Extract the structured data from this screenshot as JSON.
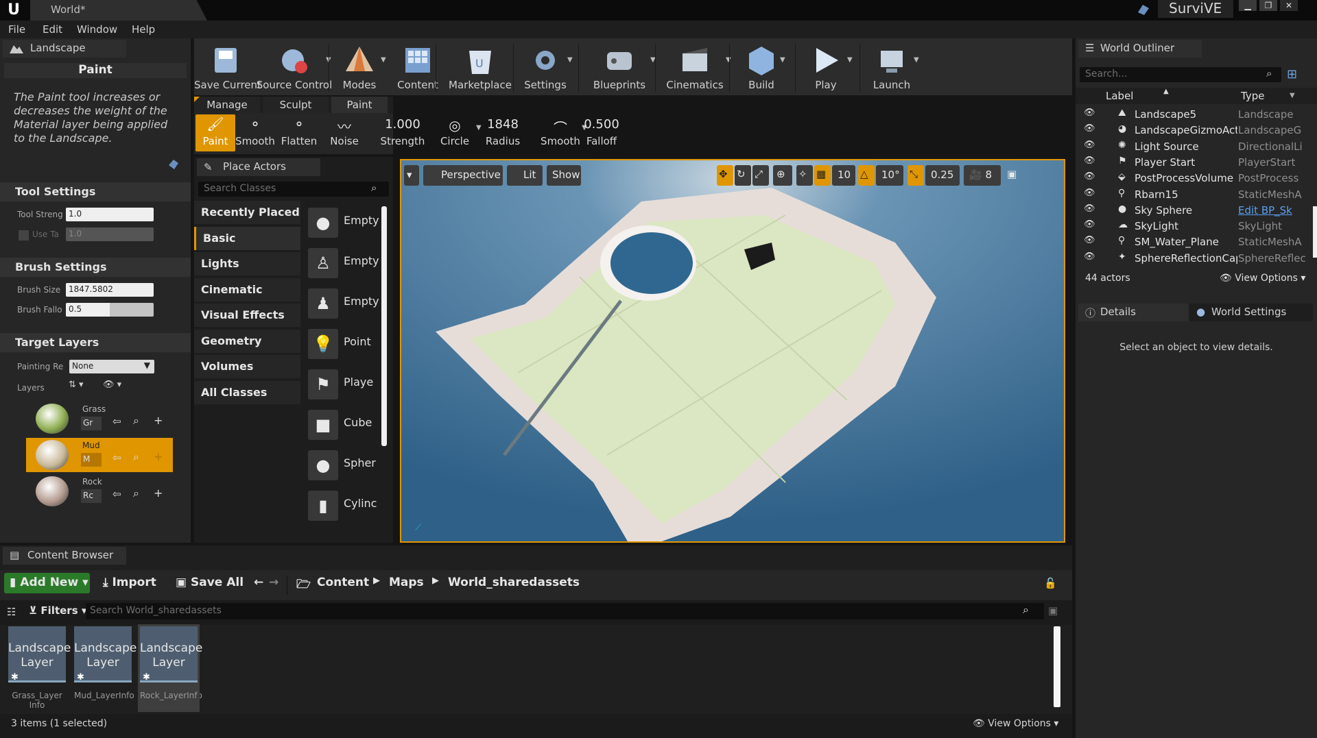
{
  "window": {
    "tab_title": "World*",
    "project_name": "SurviVE"
  },
  "menu": [
    "File",
    "Edit",
    "Window",
    "Help"
  ],
  "landscape_panel": {
    "tab": "Landscape",
    "mode_title": "Paint",
    "description": "The Paint tool increases or decreases the weight of the Material layer being applied to the Landscape.",
    "tool_settings": {
      "header": "Tool Settings",
      "tool_strength_label": "Tool Streng",
      "tool_strength_value": "1.0",
      "use_target_label": "Use Ta",
      "use_target_value": "1.0"
    },
    "brush_settings": {
      "header": "Brush Settings",
      "brush_size_label": "Brush Size",
      "brush_size_value": "1847.5802",
      "brush_falloff_label": "Brush Fallo",
      "brush_falloff_value": "0.5",
      "brush_falloff_fraction": 0.5
    },
    "target_layers": {
      "header": "Target Layers",
      "painting_label": "Painting Re",
      "painting_value": "None",
      "layers_label": "Layers",
      "items": [
        {
          "name": "Grass",
          "info": "Gr",
          "color": "#8fae52"
        },
        {
          "name": "Mud",
          "info": "M",
          "color": "#c9b99a"
        },
        {
          "name": "Rock",
          "info": "Rc",
          "color": "#b49b8f"
        }
      ]
    }
  },
  "toolbar": {
    "buttons": [
      "Save Current",
      "Source Control",
      "Modes",
      "Content",
      "Marketplace",
      "Settings",
      "Blueprints",
      "Cinematics",
      "Build",
      "Play",
      "Launch"
    ]
  },
  "mode_tabs": [
    "Manage",
    "Sculpt",
    "Paint"
  ],
  "paint_tools": [
    "Paint",
    "Smooth",
    "Flatten",
    "Noise"
  ],
  "paint_params": [
    {
      "value": "1.000",
      "label": "Strength"
    },
    {
      "value": "",
      "label": "Circle"
    },
    {
      "value": "1848",
      "label": "Radius"
    },
    {
      "value": "",
      "label": "Smooth"
    },
    {
      "value": "0.500",
      "label": "Falloff"
    }
  ],
  "place_actors": {
    "tab": "Place Actors",
    "search_placeholder": "Search Classes",
    "categories": [
      "Recently Placed",
      "Basic",
      "Lights",
      "Cinematic",
      "Visual Effects",
      "Geometry",
      "Volumes",
      "All Classes"
    ],
    "selected_category": "Basic",
    "items": [
      "Empty",
      "Empty",
      "Empty",
      "Point",
      "Playe",
      "Cube",
      "Spher",
      "Cylinc"
    ]
  },
  "viewport": {
    "perspective": "Perspective",
    "lit": "Lit",
    "show": "Show",
    "grid_snap": "10",
    "rot_snap": "10°",
    "scale_snap": "0.25",
    "camera_speed": "8"
  },
  "outliner": {
    "tab": "World Outliner",
    "search_placeholder": "Search...",
    "col_label": "Label",
    "col_type": "Type",
    "rows": [
      {
        "name": "Landscape5",
        "type": "Landscape"
      },
      {
        "name": "LandscapeGizmoActi",
        "type": "LandscapeG"
      },
      {
        "name": "Light Source",
        "type": "DirectionalLi"
      },
      {
        "name": "Player Start",
        "type": "PlayerStart"
      },
      {
        "name": "PostProcessVolume",
        "type": "PostProcess"
      },
      {
        "name": "Rbarn15",
        "type": "StaticMeshA"
      },
      {
        "name": "Sky Sphere",
        "type": "Edit BP_Sk"
      },
      {
        "name": "SkyLight",
        "type": "SkyLight"
      },
      {
        "name": "SM_Water_Plane",
        "type": "StaticMeshA"
      },
      {
        "name": "SphereReflectionCapt",
        "type": "SphereReflec"
      }
    ],
    "count": "44 actors",
    "view_options": "View Options"
  },
  "details": {
    "tab": "Details",
    "tab2": "World Settings",
    "empty_text": "Select an object to view details."
  },
  "content_browser": {
    "tab": "Content Browser",
    "add_new": "Add New",
    "import": "Import",
    "save_all": "Save All",
    "path": [
      "Content",
      "Maps",
      "World_sharedassets"
    ],
    "filters": "Filters",
    "search_placeholder": "Search World_sharedassets",
    "assets": [
      {
        "thumb": "Landscape Layer",
        "name": "Grass_Layer Info"
      },
      {
        "thumb": "Landscape Layer",
        "name": "Mud_LayerInfo"
      },
      {
        "thumb": "Landscape Layer",
        "name": "Rock_LayerInfo"
      }
    ],
    "status": "3 items (1 selected)",
    "view_options": "View Options"
  }
}
